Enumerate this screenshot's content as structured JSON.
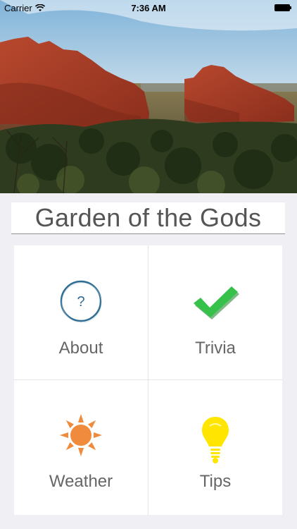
{
  "status_bar": {
    "carrier": "Carrier",
    "time": "7:36 AM",
    "wifi_icon": "wifi-icon",
    "battery_icon": "battery-icon"
  },
  "title": "Garden of the Gods",
  "menu": [
    {
      "label": "About",
      "icon": "question-circle-icon"
    },
    {
      "label": "Trivia",
      "icon": "checkmark-icon"
    },
    {
      "label": "Weather",
      "icon": "sun-icon"
    },
    {
      "label": "Tips",
      "icon": "lightbulb-icon"
    }
  ],
  "colors": {
    "about_ring": "#2e6e94",
    "trivia_check": "#36c24a",
    "weather_sun": "#f08a3c",
    "tips_bulb": "#ffe500"
  }
}
